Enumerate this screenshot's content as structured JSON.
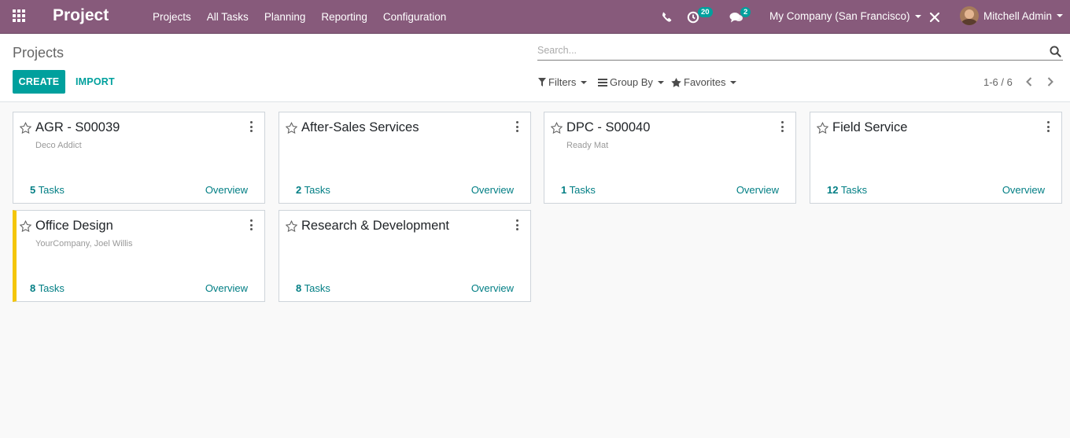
{
  "navbar": {
    "app_name": "Project",
    "menu": [
      "Projects",
      "All Tasks",
      "Planning",
      "Reporting",
      "Configuration"
    ],
    "activity_count": "20",
    "messages_count": "2",
    "company": "My Company (San Francisco)",
    "user": "Mitchell Admin",
    "colors": {
      "brand": "#875a7b",
      "accent": "#00a09d"
    }
  },
  "control": {
    "breadcrumb": "Projects",
    "search_placeholder": "Search...",
    "create_label": "CREATE",
    "import_label": "IMPORT",
    "filters_label": "Filters",
    "groupby_label": "Group By",
    "favorites_label": "Favorites",
    "pager": "1-6 / 6"
  },
  "projects": [
    {
      "name": "AGR - S00039",
      "customer": "Deco Addict",
      "tasks_count": "5",
      "tasks_label": "Tasks",
      "overview": "Overview",
      "color": ""
    },
    {
      "name": "After-Sales Services",
      "customer": "",
      "tasks_count": "2",
      "tasks_label": "Tasks",
      "overview": "Overview",
      "color": ""
    },
    {
      "name": "DPC - S00040",
      "customer": "Ready Mat",
      "tasks_count": "1",
      "tasks_label": "Tasks",
      "overview": "Overview",
      "color": ""
    },
    {
      "name": "Field Service",
      "customer": "",
      "tasks_count": "12",
      "tasks_label": "Tasks",
      "overview": "Overview",
      "color": ""
    },
    {
      "name": "Office Design",
      "customer": "YourCompany, Joel Willis",
      "tasks_count": "8",
      "tasks_label": "Tasks",
      "overview": "Overview",
      "color": "#f4c609"
    },
    {
      "name": "Research & Development",
      "customer": "",
      "tasks_count": "8",
      "tasks_label": "Tasks",
      "overview": "Overview",
      "color": ""
    }
  ]
}
